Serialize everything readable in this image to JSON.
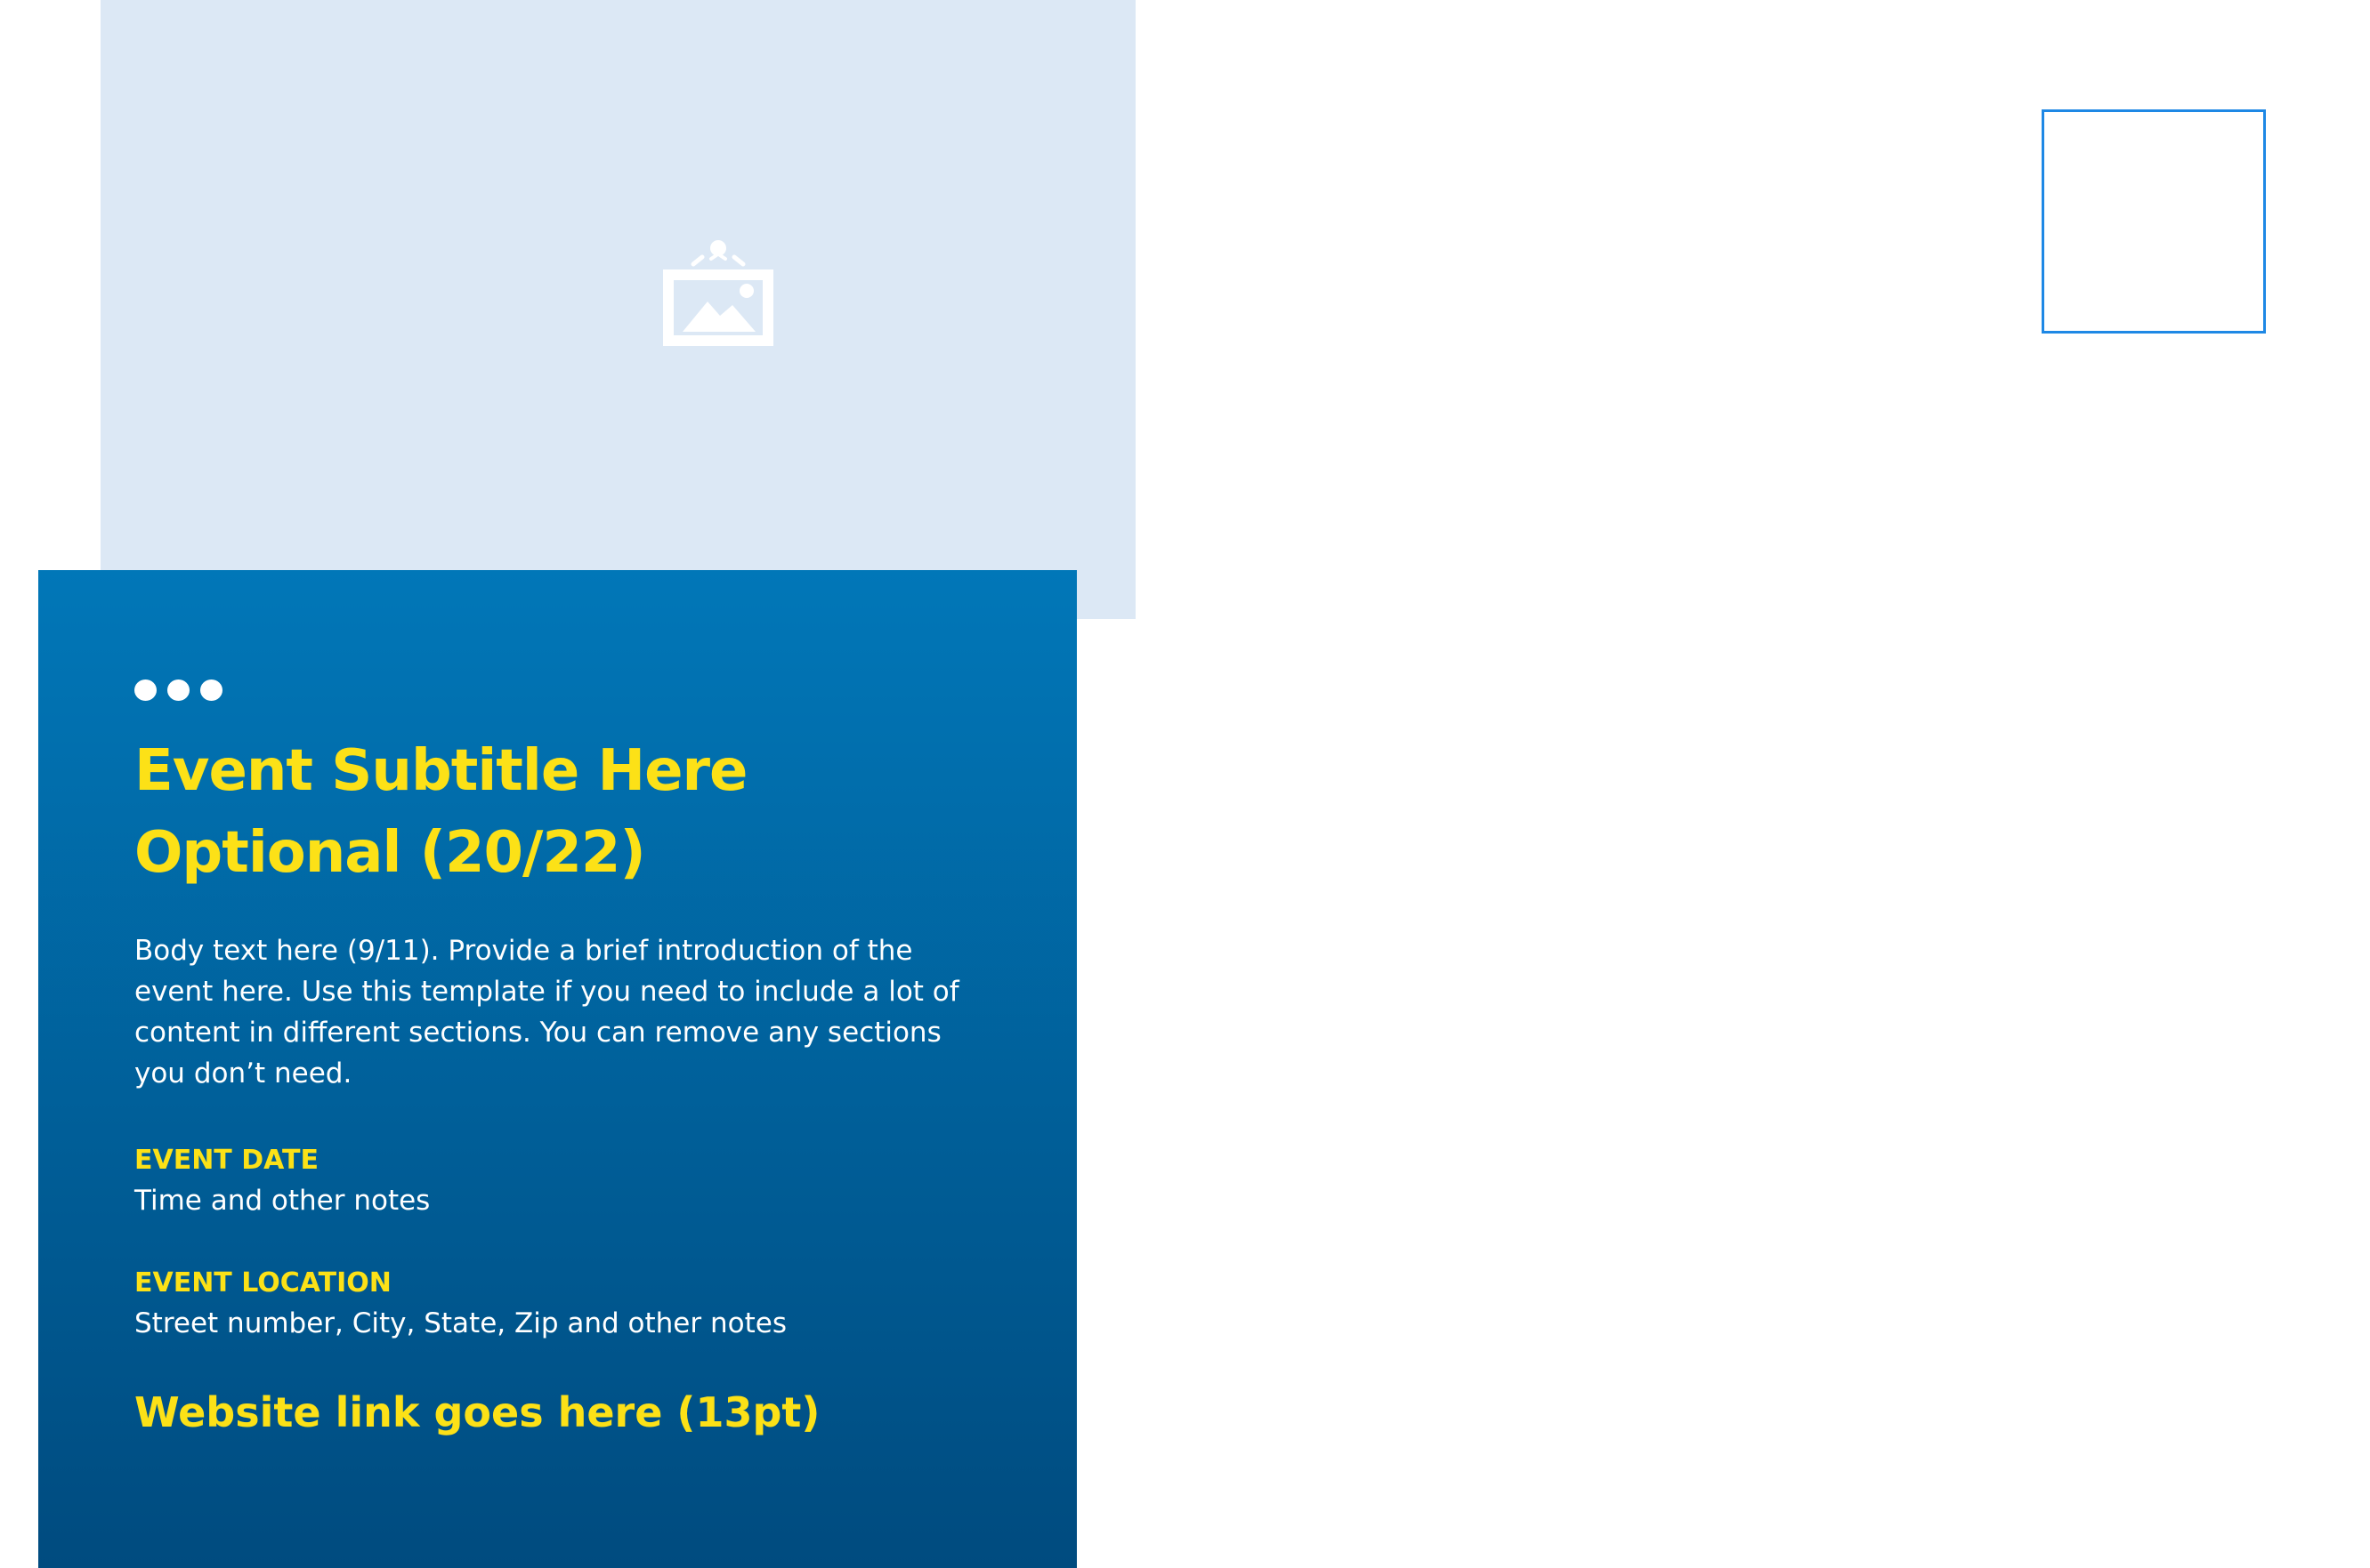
{
  "placeholder": {
    "icon": "image-icon"
  },
  "panel": {
    "subtitle_line1": "Event Subtitle Here",
    "subtitle_line2": "Optional (20/22)",
    "body": "Body text here (9/11). Provide a brief introduction of the event here. Use this template if you need to include a lot of content in different sections. You can remove any sections you don’t need.",
    "date_label": "EVENT DATE",
    "date_value": "Time and other notes",
    "location_label": "EVENT LOCATION",
    "location_value": "Street number, City, State, Zip and other notes",
    "website": "Website link goes here (13pt)"
  },
  "colors": {
    "placeholder_bg": "#dce8f5",
    "panel_top": "#0177b8",
    "panel_bottom": "#004b7f",
    "accent_yellow": "#fce117",
    "stamp_border": "#1e88e5"
  }
}
